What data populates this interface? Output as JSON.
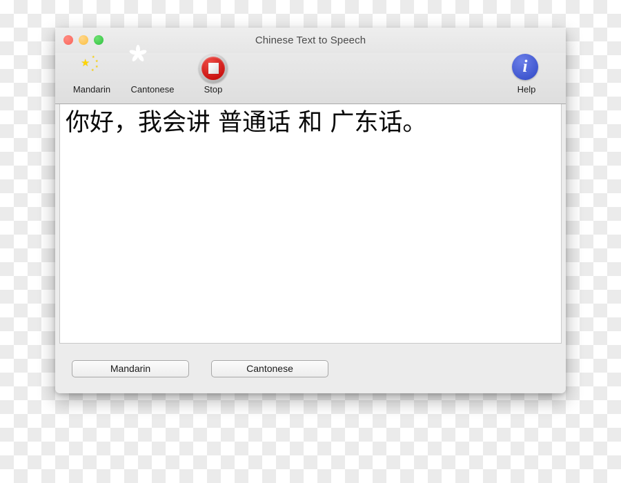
{
  "window": {
    "title": "Chinese Text to Speech",
    "traffic_lights": [
      {
        "name": "close",
        "color": "#f9655b"
      },
      {
        "name": "minimize",
        "color": "#fcbf3f"
      },
      {
        "name": "maximize",
        "color": "#2ec240"
      }
    ]
  },
  "toolbar": {
    "items": [
      {
        "label": "Mandarin",
        "icon": "china-flag-globe-icon"
      },
      {
        "label": "Cantonese",
        "icon": "hongkong-flag-globe-icon"
      },
      {
        "label": "Stop",
        "icon": "stop-icon"
      }
    ],
    "help": {
      "label": "Help",
      "icon": "info-icon",
      "glyph": "i"
    }
  },
  "text_area": {
    "content": "你好，我会讲 普通话 和 广东话。"
  },
  "bottom_bar": {
    "buttons": [
      {
        "label": "Mandarin"
      },
      {
        "label": "Cantonese"
      }
    ]
  },
  "colors": {
    "flag_red": "#c9110f",
    "help_blue": "#3f56cf",
    "window_chrome": "#ececec",
    "text_area_bg": "#ffffff"
  }
}
